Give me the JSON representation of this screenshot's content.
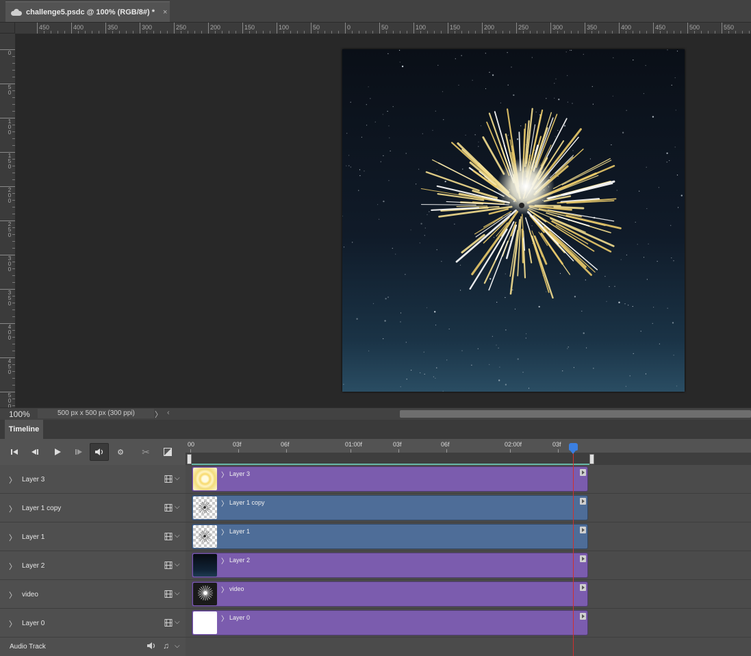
{
  "document": {
    "tab_title": "challenge5.psdc @ 100% (RGB/8#) *",
    "close_glyph": "×",
    "cloud_icon": "cloud-document-icon"
  },
  "ruler": {
    "horizontal_labels": [
      "450",
      "400",
      "350",
      "300",
      "250",
      "200",
      "150",
      "100",
      "50",
      "0",
      "50",
      "100",
      "150",
      "200",
      "250",
      "300",
      "350",
      "400",
      "450",
      "500",
      "550"
    ],
    "vertical_labels": [
      "0",
      "50",
      "100",
      "150",
      "200",
      "250",
      "300",
      "350",
      "400",
      "450",
      "500"
    ]
  },
  "status": {
    "zoom": "100%",
    "doc_info": "500 px x 500 px (300 ppi)",
    "arrow_right": "〉",
    "arrow_left": "‹"
  },
  "timeline": {
    "tab_label": "Timeline",
    "controls": {
      "first_frame": "⏮",
      "prev_frame": "◀▏",
      "play": "▶",
      "next_frame": "▕▶",
      "audio": "🔈",
      "settings": "⚙",
      "split": "✂",
      "transition": "◪"
    },
    "time_labels": [
      "00",
      "03f",
      "06f",
      "01:00f",
      "03f",
      "06f",
      "02:00f",
      "03f"
    ],
    "layers": [
      {
        "name": "Layer 3",
        "clip_label": "Layer 3",
        "color": "#7b5cae",
        "thumb": "glow"
      },
      {
        "name": "Layer 1 copy",
        "clip_label": "Layer 1 copy",
        "color": "#4e6d98",
        "thumb": "checker"
      },
      {
        "name": "Layer 1",
        "clip_label": "Layer 1",
        "color": "#4e6d98",
        "thumb": "checker"
      },
      {
        "name": "Layer 2",
        "clip_label": "Layer 2",
        "color": "#7b5cae",
        "thumb": "night"
      },
      {
        "name": "video",
        "clip_label": "video",
        "color": "#7b5cae",
        "thumb": "firework"
      },
      {
        "name": "Layer 0",
        "clip_label": "Layer 0",
        "color": "#7b5cae",
        "thumb": "white"
      }
    ],
    "row_icons": {
      "chevron": "〉",
      "film": "🎞",
      "dropdown": "⌵"
    },
    "audio_track": {
      "label": "Audio Track",
      "volume_icon": "🔈",
      "note_icon": "♫",
      "dropdown": "⌵"
    }
  },
  "colors": {
    "accent": "#3b7fe0",
    "playhead": "#d0302e",
    "clip_purple": "#7b5cae",
    "clip_blue": "#4e6d98"
  }
}
